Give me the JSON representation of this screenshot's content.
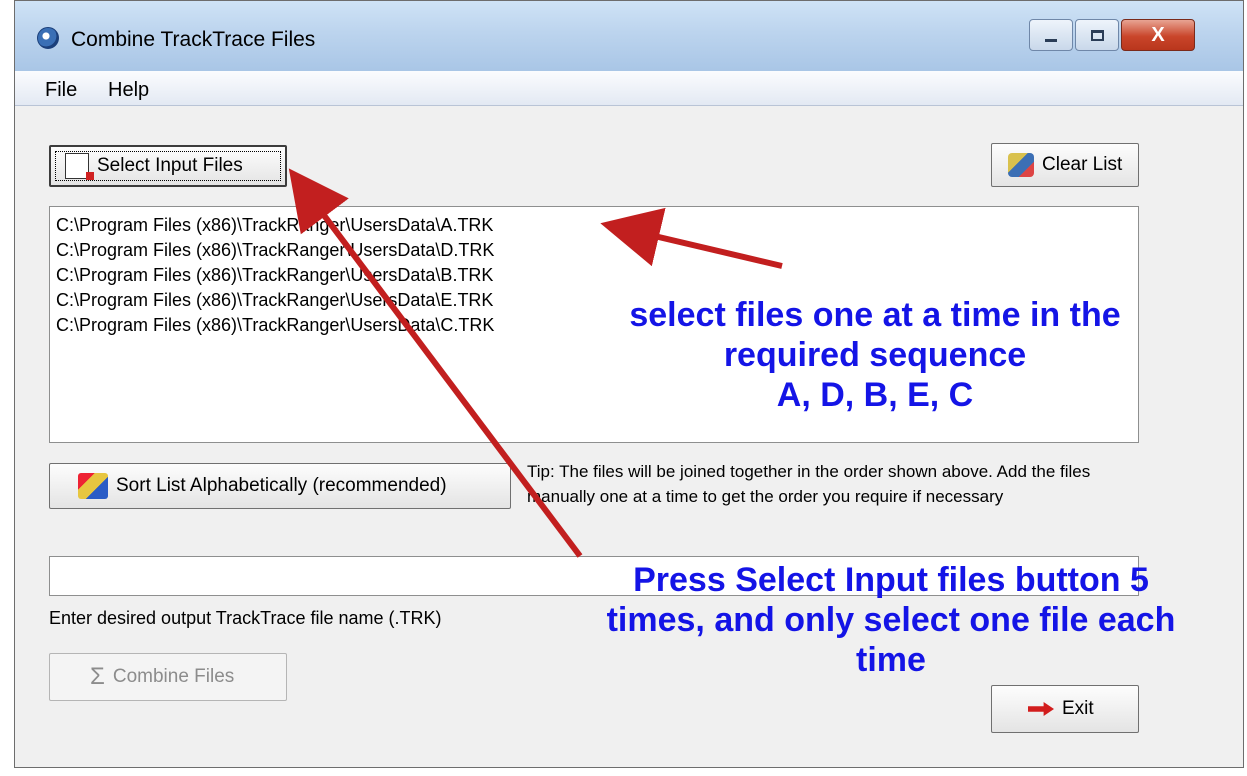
{
  "window": {
    "title": "Combine TrackTrace Files",
    "close_glyph": "X"
  },
  "menu": [
    "File",
    "Help"
  ],
  "buttons": {
    "select_input": "Select Input Files",
    "clear_list": "Clear List",
    "sort": "Sort List Alphabetically (recommended)",
    "combine": "Combine Files",
    "exit": "Exit"
  },
  "file_list": [
    "C:\\Program Files (x86)\\TrackRanger\\UsersData\\A.TRK",
    "C:\\Program Files (x86)\\TrackRanger\\UsersData\\D.TRK",
    "C:\\Program Files (x86)\\TrackRanger\\UsersData\\B.TRK",
    "C:\\Program Files (x86)\\TrackRanger\\UsersData\\E.TRK",
    "C:\\Program Files (x86)\\TrackRanger\\UsersData\\C.TRK"
  ],
  "tip": "Tip: The files will be joined together in the order shown above. Add the files manually one at a time to get the order you require if necessary",
  "output": {
    "value": "",
    "label": "Enter desired output TrackTrace file name (.TRK)"
  },
  "annotations": {
    "select_files": [
      "select files one at a time in the",
      "required sequence",
      "A, D, B, E, C"
    ],
    "press_button": [
      "Press Select Input files button 5",
      "times, and only select one file each",
      "time"
    ]
  },
  "colors": {
    "annotation_text": "#1414e6",
    "annotation_arrow": "#c21f1f"
  },
  "icons": {
    "app": "app-icon",
    "select_input": "document-add-icon",
    "clear_list": "clear-icon",
    "sort": "sort-icon",
    "combine": "sigma-icon",
    "exit": "red-arrow-icon"
  }
}
